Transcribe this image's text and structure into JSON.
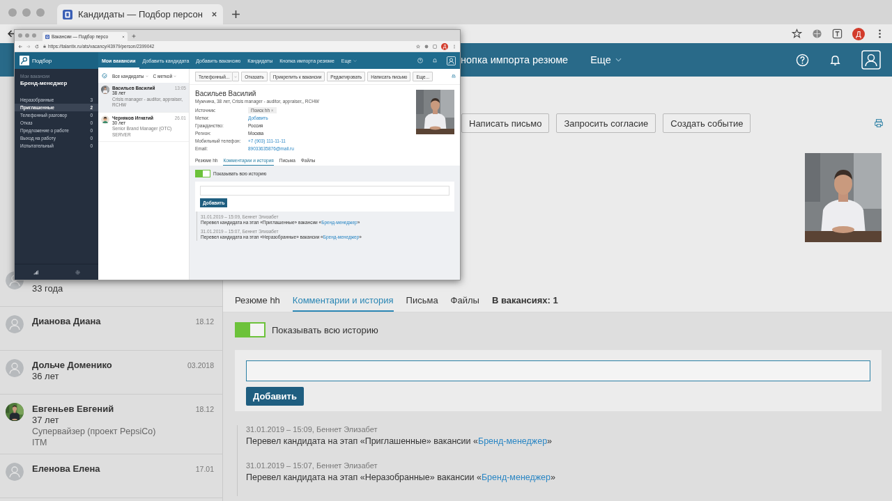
{
  "browser": {
    "tab_title": "Кандидаты — Подбор персон",
    "profile_initial": "Д"
  },
  "app_header": {
    "nav_item": "нопка импорта резюме",
    "more": "Еще"
  },
  "candidates": [
    {
      "age": "33 года",
      "kind": "placeholder"
    },
    {
      "name": "Дианова Диана",
      "date": "18.12",
      "kind": "placeholder"
    },
    {
      "name": "Дольче Доменико",
      "date": "03.2018",
      "age": "36 лет",
      "kind": "placeholder"
    },
    {
      "name": "Евгеньев Евгений",
      "date": "18.12",
      "age": "37 лет",
      "position": "Супервайзер (проект PepsiCo)",
      "company": "ITM"
    },
    {
      "name": "Еленова Елена",
      "date": "17.01",
      "kind": "placeholder"
    }
  ],
  "actions": [
    "Написать письмо",
    "Запросить согласие",
    "Создать событие"
  ],
  "profile_tabs": [
    {
      "label": "Резюме hh",
      "selected": false,
      "kind": "tab"
    },
    {
      "label": "Комментарии и история",
      "selected": true,
      "kind": "tab"
    },
    {
      "label": "Письма",
      "selected": false,
      "kind": "tab"
    },
    {
      "label": "Файлы",
      "selected": false,
      "kind": "tab"
    },
    {
      "label": "В вакансиях: 1",
      "selected": false,
      "kind": "count"
    }
  ],
  "history_toggle": {
    "on": true,
    "label": "Показывать всю историю"
  },
  "comment_button": "Добавить",
  "history": [
    {
      "meta": "31.01.2019 – 15:09, Беннет Элизабет",
      "before": "Перевел кандидата на этап «Приглашенные» вакансии «",
      "link": "Бренд-менеджер",
      "after": "»"
    },
    {
      "meta": "31.01.2019 – 15:07, Беннет Элизабет",
      "before": "Перевел кандидата на этап «Неразобранные» вакансии «",
      "link": "Бренд-менеджер",
      "after": "»"
    }
  ],
  "overlay_window": {
    "tab_title": "Вакансии — Подбор персо",
    "url": "https://talantix.ru/ats/vacancy/43979/person/2399042",
    "profile_initial": "Д",
    "logo": "Подбор",
    "nav": [
      {
        "label": "Мои вакансии",
        "selected": true,
        "kind": "link"
      },
      {
        "label": "Добавить кандидата",
        "selected": false,
        "kind": "link"
      },
      {
        "label": "Добавить вакансию",
        "selected": false,
        "kind": "link"
      },
      {
        "label": "Кандидаты",
        "selected": false,
        "kind": "link"
      },
      {
        "label": "Кнопка импорта резюме",
        "selected": false,
        "kind": "link"
      },
      {
        "label": "Еще",
        "selected": false,
        "kind": "menu"
      }
    ],
    "sidebar": {
      "caption": "Мои вакансии",
      "vacancy": "Бренд-менеджер",
      "stages": [
        {
          "label": "Неразобранные",
          "count": "3",
          "selected": false
        },
        {
          "label": "Приглашенные",
          "count": "2",
          "selected": true
        },
        {
          "label": "Телефонный разговор",
          "count": "0",
          "selected": false
        },
        {
          "label": "Отказ",
          "count": "0",
          "selected": false
        },
        {
          "label": "Предложение о работе",
          "count": "0",
          "selected": false
        },
        {
          "label": "Выход на работу",
          "count": "0",
          "selected": false
        },
        {
          "label": "Испытательный",
          "count": "0",
          "selected": false
        }
      ]
    },
    "filters": [
      "Все кандидаты",
      "С меткой"
    ],
    "candidates": [
      {
        "name": "Васильев Василий",
        "time": "13:05",
        "age": "38 лет",
        "position": "Crisis manager - auditor, appraiser,",
        "company": "RCHW",
        "selected": true
      },
      {
        "name": "Черняков Игнатий",
        "time": "26.01",
        "age": "30 лет",
        "position": "Senior Brand Manager (OTC)",
        "company": "SERVER",
        "selected": false,
        "kind": "cartoon"
      }
    ],
    "actions": [
      {
        "label": "Телефонный...",
        "kind": "split"
      },
      {
        "label": "Отказать",
        "kind": "plain"
      },
      {
        "label": "Прикрепить к вакансии",
        "kind": "plain"
      },
      {
        "label": "Редактировать",
        "kind": "plain"
      },
      {
        "label": "Написать письмо",
        "kind": "plain"
      },
      {
        "label": "Еще...",
        "kind": "plain"
      }
    ],
    "person": {
      "name": "Васильев Василий",
      "summary": "Мужчина, 38 лет, Crisis manager - auditor, appraiser,, RCHW",
      "fields": [
        {
          "label": "Источник:",
          "value": "Поиск hh",
          "remove": "×",
          "kind": "tag"
        },
        {
          "label": "Метки:",
          "value": "Добавить",
          "kind": "link"
        },
        {
          "label": "Гражданство:",
          "value": "Россия",
          "kind": "text"
        },
        {
          "label": "Регион:",
          "value": "Москва",
          "kind": "text"
        },
        {
          "label": "Мобильный телефон:",
          "value": "+7 (903) 111-11-11",
          "kind": "link"
        },
        {
          "label": "Email:",
          "value": "89033635876@mail.ru",
          "kind": "link"
        }
      ]
    },
    "tabs": [
      {
        "label": "Резюме hh",
        "selected": false
      },
      {
        "label": "Комментарии и история",
        "selected": true
      },
      {
        "label": "Письма",
        "selected": false
      },
      {
        "label": "Файлы",
        "selected": false
      }
    ],
    "history_toggle": {
      "on": true,
      "label": "Показывать всю историю"
    },
    "comment_button": "Добавить",
    "history": [
      {
        "meta": "31.01.2019 – 15:09, Беннет Элизабет",
        "before": "Перевел кандидата на этап «Приглашенные» вакансии «",
        "link": "Бренд-менеджер",
        "after": "»"
      },
      {
        "meta": "31.01.2019 – 15:07, Беннет Элизабет",
        "before": "Перевел кандидата на этап «Неразобранные» вакансии «",
        "link": "Бренд-менеджер",
        "after": "»"
      }
    ]
  }
}
